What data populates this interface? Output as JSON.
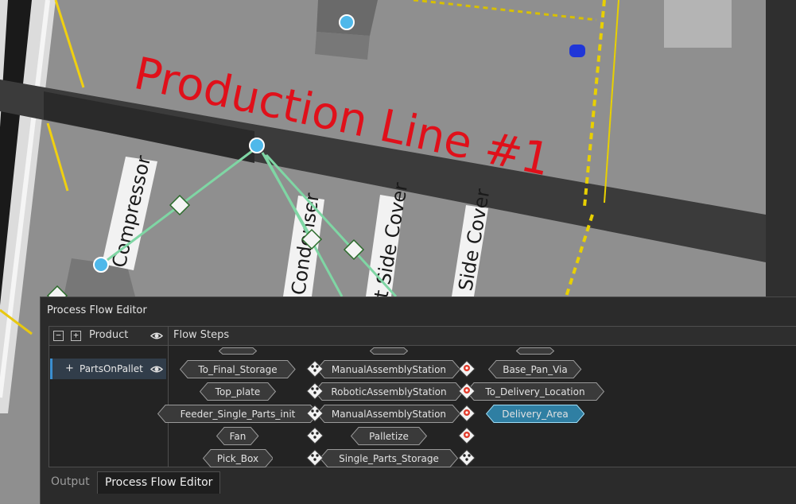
{
  "scene": {
    "title": "Production Line #1",
    "station_labels": [
      "Compressor",
      "Condenser",
      "t Side Cover",
      "Side Cover"
    ]
  },
  "editor": {
    "title": "Process Flow Editor",
    "left_header": "Product",
    "right_header": "Flow Steps",
    "products": [
      {
        "label": "PartsOnPallet",
        "selected": true
      }
    ],
    "columns": {
      "col1": [
        "To_Final_Storage",
        "Top_plate",
        "Feeder_Single_Parts_init",
        "Fan",
        "Pick_Box"
      ],
      "col2": [
        "ManualAssemblyStation",
        "RoboticAssemblyStation",
        "ManualAssemblyStation",
        "Palletize",
        "Single_Parts_Storage"
      ],
      "col3": [
        "Base_Pan_Via",
        "To_Delivery_Location",
        "Delivery_Area"
      ]
    },
    "selected_step": "Delivery_Area",
    "tabs": [
      {
        "label": "Output",
        "active": false
      },
      {
        "label": "Process Flow Editor",
        "active": true
      }
    ]
  },
  "colors": {
    "accent": "#3b8fd0",
    "title_red": "#e0101a",
    "selected_node": "#2f7fa3",
    "flow_line": "#7fd6a4"
  }
}
